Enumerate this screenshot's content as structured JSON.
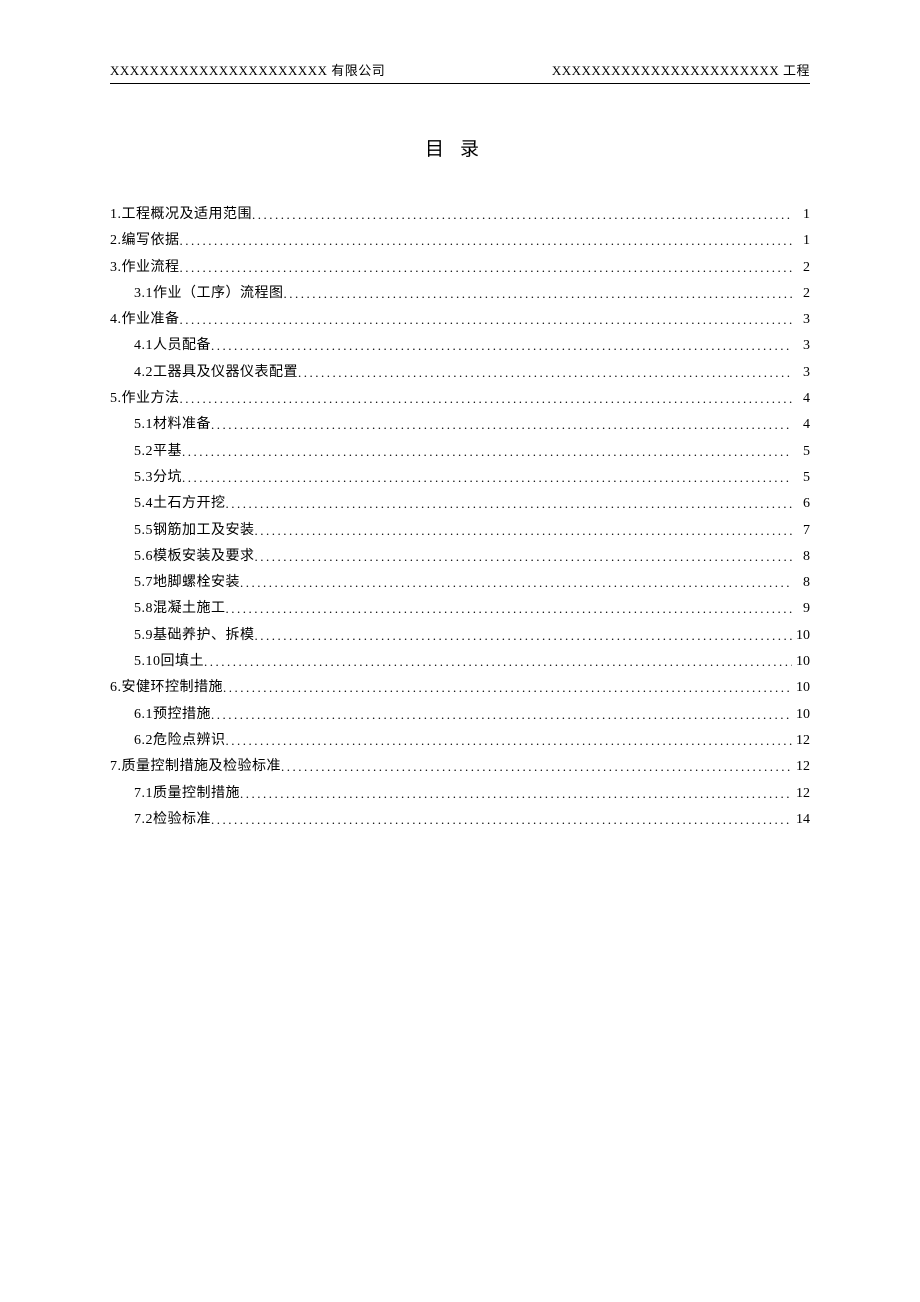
{
  "header": {
    "left": "XXXXXXXXXXXXXXXXXXXXXX 有限公司",
    "right": "XXXXXXXXXXXXXXXXXXXXXXX 工程"
  },
  "title": "目录",
  "toc": [
    {
      "num": "1.",
      "text": "工程概况及适用范围",
      "page": "1",
      "indent": 0
    },
    {
      "num": "2.",
      "text": "编写依据",
      "page": "1",
      "indent": 0
    },
    {
      "num": "3.",
      "text": "作业流程",
      "page": "2",
      "indent": 0
    },
    {
      "num": "3.1",
      "text": "作业（工序）流程图 ",
      "page": "2",
      "indent": 1
    },
    {
      "num": "4.",
      "text": "作业准备",
      "page": "3",
      "indent": 0
    },
    {
      "num": "4.1",
      "text": " 人员配备",
      "page": "3",
      "indent": 1
    },
    {
      "num": "4.2",
      "text": " 工器具及仪器仪表配置",
      "page": "3",
      "indent": 1
    },
    {
      "num": "5.",
      "text": "作业方法",
      "page": "4",
      "indent": 0
    },
    {
      "num": "5.1",
      "text": " 材料准备",
      "page": "4",
      "indent": 1
    },
    {
      "num": "5.2",
      "text": " 平基",
      "page": "5",
      "indent": 1
    },
    {
      "num": "5.3",
      "text": " 分坑",
      "page": "5",
      "indent": 1
    },
    {
      "num": "5.4",
      "text": " 土石方开挖",
      "page": "6",
      "indent": 1
    },
    {
      "num": "5.5",
      "text": " 钢筋加工及安装",
      "page": "7",
      "indent": 1
    },
    {
      "num": "5.6",
      "text": " 模板安装及要求",
      "page": "8",
      "indent": 1
    },
    {
      "num": "5.7",
      "text": " 地脚螺栓安装",
      "page": "8",
      "indent": 1
    },
    {
      "num": "5.8",
      "text": " 混凝土施工",
      "page": "9",
      "indent": 1
    },
    {
      "num": "5.9",
      "text": " 基础养护、拆模",
      "page": "10",
      "indent": 1
    },
    {
      "num": "5.10",
      "text": " 回填土",
      "page": "10",
      "indent": 1
    },
    {
      "num": "6.",
      "text": "安健环控制措施",
      "page": "10",
      "indent": 0
    },
    {
      "num": "6.1",
      "text": " 预控措施",
      "page": "10",
      "indent": 1
    },
    {
      "num": "6.2",
      "text": "危险点辨识 ",
      "page": "12",
      "indent": 1
    },
    {
      "num": "7.",
      "text": "质量控制措施及检验标准",
      "page": "12",
      "indent": 0
    },
    {
      "num": "7.1",
      "text": " 质量控制措施",
      "page": "12",
      "indent": 1
    },
    {
      "num": "7.2",
      "text": " 检验标准",
      "page": "14",
      "indent": 1
    }
  ]
}
